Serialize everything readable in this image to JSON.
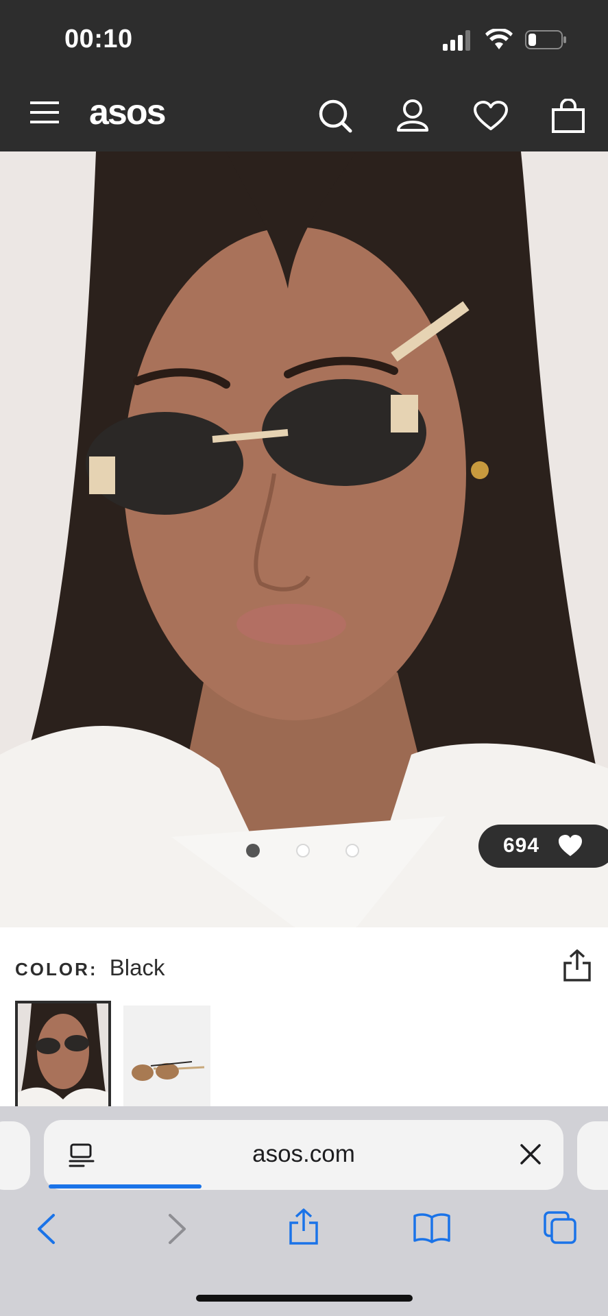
{
  "status_bar": {
    "time": "00:10",
    "battery_level": 0.25
  },
  "header": {
    "logo": "asos",
    "icons": [
      "menu-icon",
      "search-icon",
      "account-icon",
      "heart-icon",
      "bag-icon"
    ],
    "background": "#2d2d2d"
  },
  "product": {
    "likes_count": "694",
    "gallery": {
      "total_images": 3,
      "active_index": 0
    },
    "color_label": "COLOR:",
    "color_value": "Black",
    "swatches": [
      {
        "name": "Black",
        "selected": true
      },
      {
        "name": "Brown",
        "selected": false
      }
    ]
  },
  "browser": {
    "url": "asos.com",
    "load_progress": 0.3,
    "accent": "#1a73e8",
    "toolbar_icons": [
      "back-icon",
      "forward-icon",
      "share-icon",
      "bookmarks-icon",
      "tabs-icon"
    ]
  }
}
